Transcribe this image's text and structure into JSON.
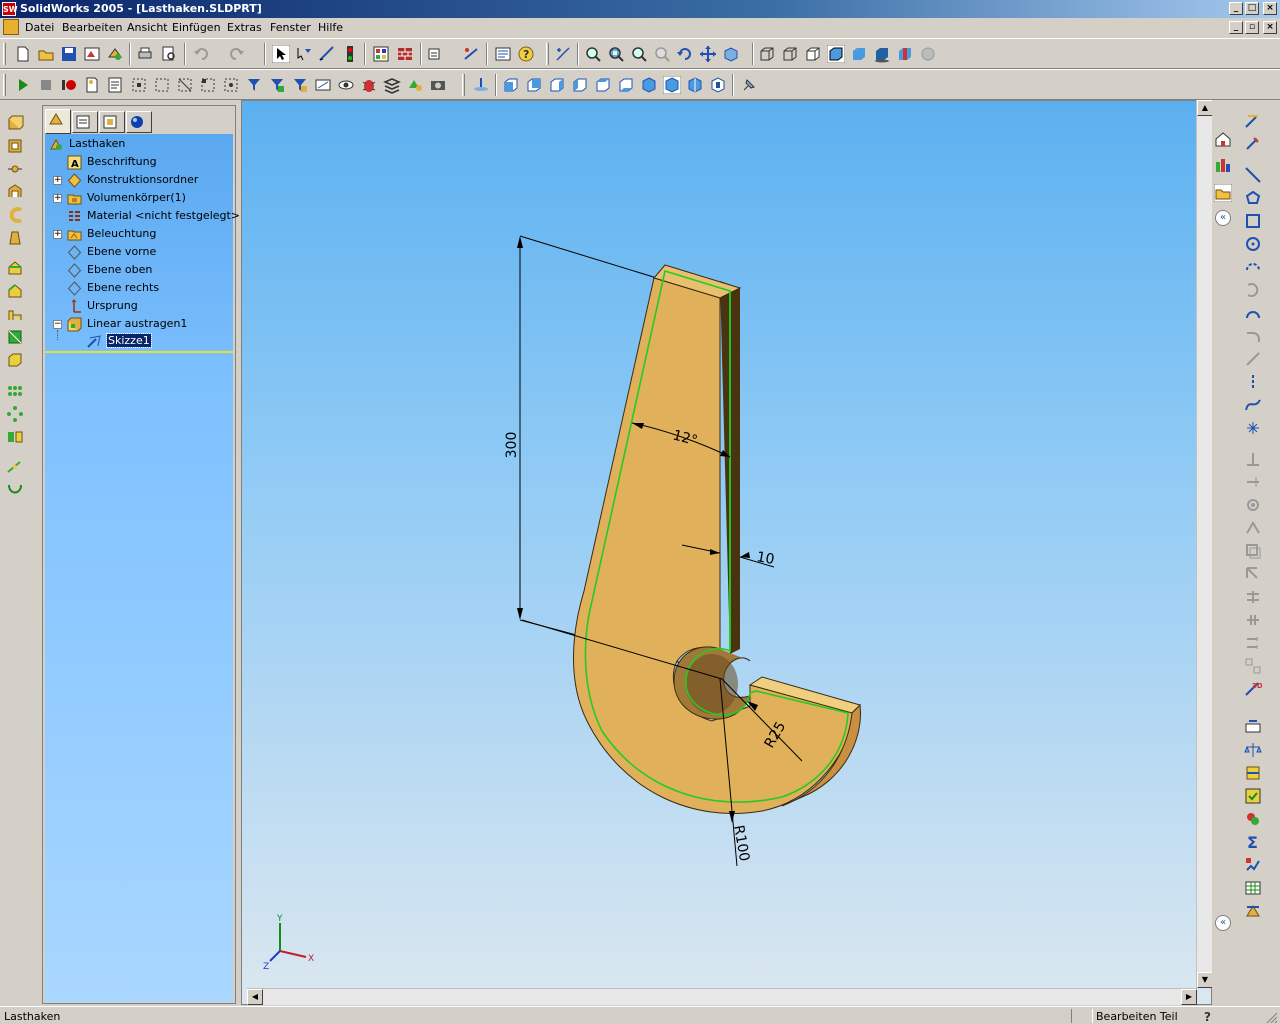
{
  "window": {
    "title": "SolidWorks 2005 - [Lasthaken.SLDPRT]",
    "logo_text": "SW"
  },
  "menu": [
    "Datei",
    "Bearbeiten",
    "Ansicht",
    "Einfügen",
    "Extras",
    "Fenster",
    "Hilfe"
  ],
  "feature_tree": {
    "root": "Lasthaken",
    "items": [
      {
        "label": "Beschriftung",
        "icon": "annotation-icon",
        "expandable": false
      },
      {
        "label": "Konstruktionsordner",
        "icon": "design-binder-icon",
        "expandable": true
      },
      {
        "label": "Volumenkörper(1)",
        "icon": "solid-bodies-folder-icon",
        "expandable": true
      },
      {
        "label": "Material <nicht festgelegt>",
        "icon": "material-icon",
        "expandable": false
      },
      {
        "label": "Beleuchtung",
        "icon": "lighting-folder-icon",
        "expandable": true
      },
      {
        "label": "Ebene vorne",
        "icon": "plane-icon",
        "expandable": false
      },
      {
        "label": "Ebene oben",
        "icon": "plane-icon",
        "expandable": false
      },
      {
        "label": "Ebene rechts",
        "icon": "plane-icon",
        "expandable": false
      },
      {
        "label": "Ursprung",
        "icon": "origin-icon",
        "expandable": false
      },
      {
        "label": "Linear austragen1",
        "icon": "extrude-feature-icon",
        "expandable": true,
        "expanded": true
      }
    ],
    "child": {
      "label": "Skizze1",
      "icon": "sketch-icon",
      "selected": true
    }
  },
  "dimensions": {
    "height": "300",
    "angle": "12°",
    "thickness": "10",
    "inner_radius": "R25",
    "outer_radius": "R100"
  },
  "triad": {
    "x": "X",
    "y": "Y",
    "z": "Z"
  },
  "status": {
    "left": "Lasthaken",
    "mode": "Bearbeiten Teil"
  },
  "colors": {
    "part_face": "#e0b05a",
    "part_side": "#b78a3c",
    "part_dark": "#4a3410",
    "sketch_green": "#22cc22",
    "viewport_top": "#5bb0f0",
    "viewport_bottom": "#dbe7f0"
  }
}
